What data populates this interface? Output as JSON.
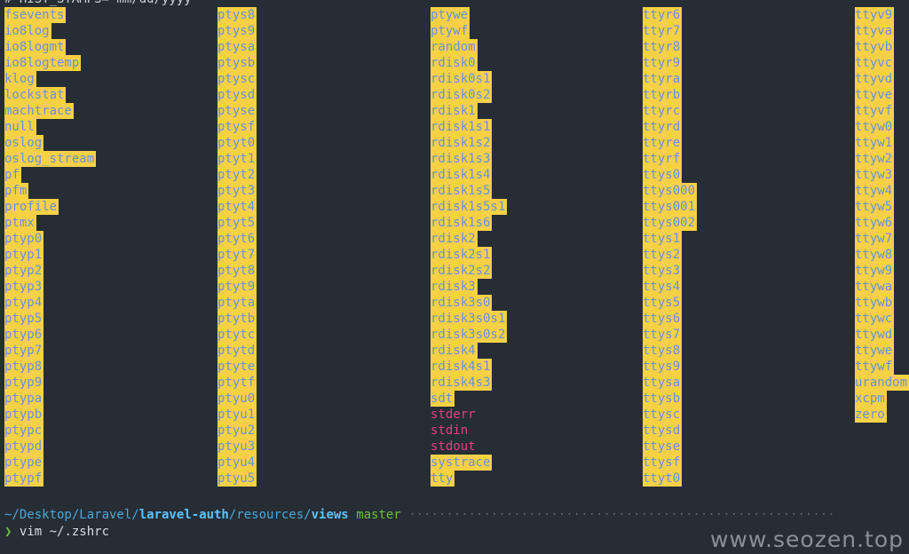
{
  "top_text": "# HIST_STAMPS=\"mm/dd/yyyy\"",
  "columns": [
    [
      "fsevents",
      "io8log",
      "io8logmt",
      "io8logtemp",
      "klog",
      "lockstat",
      "machtrace",
      "null",
      "oslog",
      "oslog_stream",
      "pf",
      "pfm",
      "profile",
      "ptmx",
      "ptyp0",
      "ptyp1",
      "ptyp2",
      "ptyp3",
      "ptyp4",
      "ptyp5",
      "ptyp6",
      "ptyp7",
      "ptyp8",
      "ptyp9",
      "ptypa",
      "ptypb",
      "ptypc",
      "ptypd",
      "ptype",
      "ptypf"
    ],
    [
      "ptys8",
      "ptys9",
      "ptysa",
      "ptysb",
      "ptysc",
      "ptysd",
      "ptyse",
      "ptysf",
      "ptyt0",
      "ptyt1",
      "ptyt2",
      "ptyt3",
      "ptyt4",
      "ptyt5",
      "ptyt6",
      "ptyt7",
      "ptyt8",
      "ptyt9",
      "ptyta",
      "ptytb",
      "ptytc",
      "ptytd",
      "ptyte",
      "ptytf",
      "ptyu0",
      "ptyu1",
      "ptyu2",
      "ptyu3",
      "ptyu4",
      "ptyu5"
    ],
    [
      "ptywe",
      "ptywf",
      "random",
      "rdisk0",
      "rdisk0s1",
      "rdisk0s2",
      "rdisk1",
      "rdisk1s1",
      "rdisk1s2",
      "rdisk1s3",
      "rdisk1s4",
      "rdisk1s5",
      "rdisk1s5s1",
      "rdisk1s6",
      "rdisk2",
      "rdisk2s1",
      "rdisk2s2",
      "rdisk3",
      "rdisk3s0",
      "rdisk3s0s1",
      "rdisk3s0s2",
      "rdisk4",
      "rdisk4s1",
      "rdisk4s3",
      "sdt",
      "stderr",
      "stdin",
      "stdout",
      "systrace",
      "tty"
    ],
    [
      "ttyr6",
      "ttyr7",
      "ttyr8",
      "ttyr9",
      "ttyra",
      "ttyrb",
      "ttyrc",
      "ttyrd",
      "ttyre",
      "ttyrf",
      "ttys0",
      "ttys000",
      "ttys001",
      "ttys002",
      "ttys1",
      "ttys2",
      "ttys3",
      "ttys4",
      "ttys5",
      "ttys6",
      "ttys7",
      "ttys8",
      "ttys9",
      "ttysa",
      "ttysb",
      "ttysc",
      "ttysd",
      "ttyse",
      "ttysf",
      "ttyt0"
    ],
    [
      "ttyv9",
      "ttyva",
      "ttyvb",
      "ttyvc",
      "ttyvd",
      "ttyve",
      "ttyvf",
      "ttyw0",
      "ttyw1",
      "ttyw2",
      "ttyw3",
      "ttyw4",
      "ttyw5",
      "ttyw6",
      "ttyw7",
      "ttyw8",
      "ttyw9",
      "ttywa",
      "ttywb",
      "ttywc",
      "ttywd",
      "ttywe",
      "ttywf",
      "urandom",
      "xcpm",
      "zero"
    ]
  ],
  "plain_entries": [
    "stderr",
    "stdin",
    "stdout"
  ],
  "prompt": {
    "path_prefix": "~/Desktop/Laravel/",
    "repo": "laravel-auth",
    "path_middle": "/resources/",
    "dir": "views",
    "branch": "master",
    "filler": "·························································",
    "arrow": "❯",
    "command": "vim ~/.zshrc"
  },
  "watermark": "www.seozen.top",
  "colors": {
    "background": "#262d34",
    "highlight": "#f6d146",
    "entry_text": "#6a8fd8",
    "stdio_text": "#e2407f",
    "path": "#4aa8d8",
    "branch": "#6dbf3e"
  }
}
